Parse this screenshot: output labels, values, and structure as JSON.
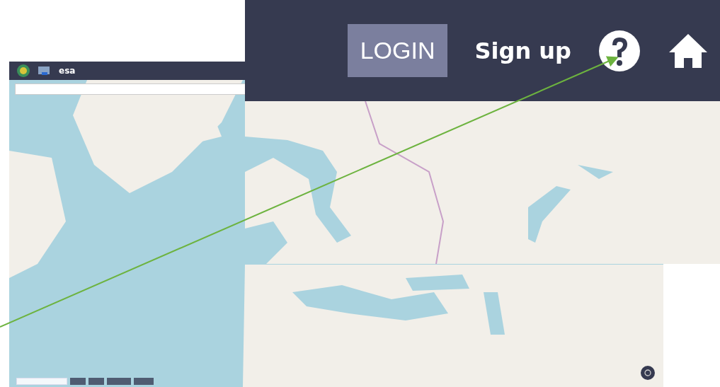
{
  "screen": {
    "header": {
      "logo_text": "esa"
    }
  },
  "zoom_inset": {
    "header": {
      "buttons": [
        {
          "label": "LOGIN",
          "kind": "boxed"
        },
        {
          "label": "Sign up",
          "kind": "plain"
        }
      ]
    }
  }
}
